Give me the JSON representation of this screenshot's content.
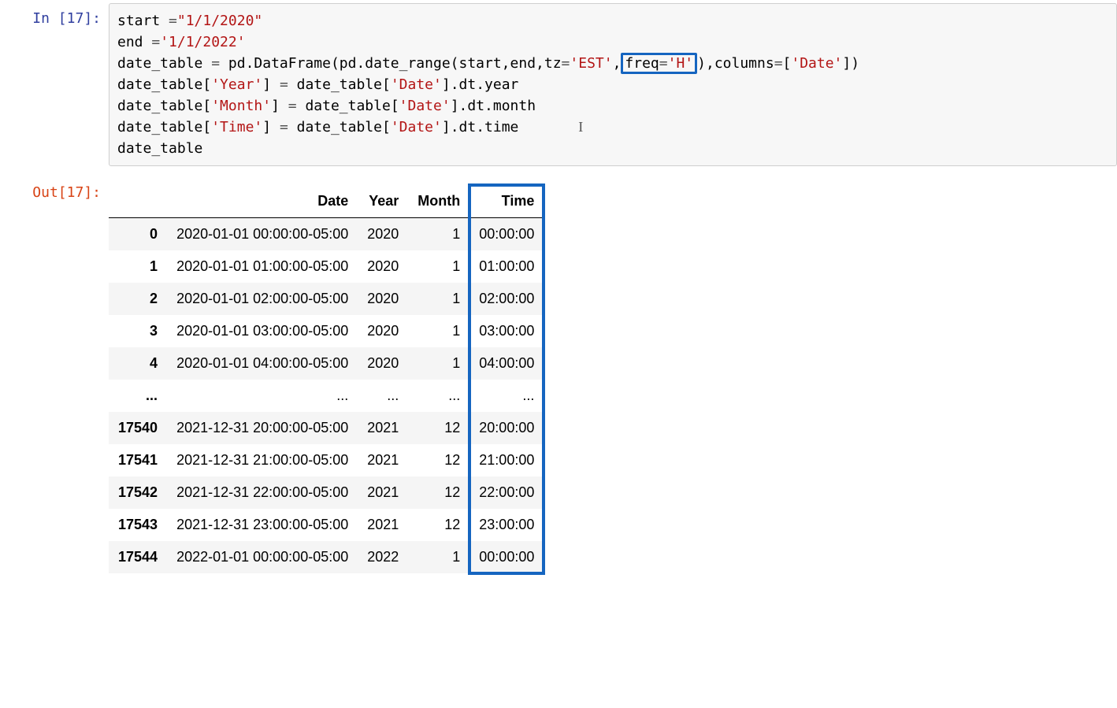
{
  "prompts": {
    "in_label": "In [17]:",
    "out_label": "Out[17]:"
  },
  "code": {
    "line1_a": "start ",
    "line1_eq": "=",
    "line1_str": "\"1/1/2020\"",
    "line2_a": "end ",
    "line2_eq": "=",
    "line2_str": "'1/1/2022'",
    "line3_a": "date_table ",
    "line3_eq": "=",
    "line3_b": " pd.DataFrame(pd.date_range(start,end,tz",
    "line3_eq2": "=",
    "line3_est": "'EST'",
    "line3_comma": ",",
    "line3_hl_a": "freq",
    "line3_hl_eq": "=",
    "line3_hl_str": "'H'",
    "line3_c": "),columns",
    "line3_eq3": "=",
    "line3_c_br": "[",
    "line3_date": "'Date'",
    "line3_c_br2": "])",
    "line4_a": "date_table[",
    "line4_year": "'Year'",
    "line4_b": "] ",
    "line4_eq": "=",
    "line4_c": " date_table[",
    "line4_date": "'Date'",
    "line4_d": "].dt.year",
    "line5_a": "date_table[",
    "line5_month": "'Month'",
    "line5_b": "] ",
    "line5_eq": "=",
    "line5_c": " date_table[",
    "line5_date": "'Date'",
    "line5_d": "].dt.month",
    "line6_a": "date_table[",
    "line6_time": "'Time'",
    "line6_b": "] ",
    "line6_eq": "=",
    "line6_c": " date_table[",
    "line6_date": "'Date'",
    "line6_d": "].dt.time",
    "line7": "date_table",
    "cursor": "I"
  },
  "table": {
    "columns": [
      "Date",
      "Year",
      "Month",
      "Time"
    ],
    "rows": [
      {
        "idx": "0",
        "Date": "2020-01-01 00:00:00-05:00",
        "Year": "2020",
        "Month": "1",
        "Time": "00:00:00"
      },
      {
        "idx": "1",
        "Date": "2020-01-01 01:00:00-05:00",
        "Year": "2020",
        "Month": "1",
        "Time": "01:00:00"
      },
      {
        "idx": "2",
        "Date": "2020-01-01 02:00:00-05:00",
        "Year": "2020",
        "Month": "1",
        "Time": "02:00:00"
      },
      {
        "idx": "3",
        "Date": "2020-01-01 03:00:00-05:00",
        "Year": "2020",
        "Month": "1",
        "Time": "03:00:00"
      },
      {
        "idx": "4",
        "Date": "2020-01-01 04:00:00-05:00",
        "Year": "2020",
        "Month": "1",
        "Time": "04:00:00"
      },
      {
        "idx": "...",
        "Date": "...",
        "Year": "...",
        "Month": "...",
        "Time": "..."
      },
      {
        "idx": "17540",
        "Date": "2021-12-31 20:00:00-05:00",
        "Year": "2021",
        "Month": "12",
        "Time": "20:00:00"
      },
      {
        "idx": "17541",
        "Date": "2021-12-31 21:00:00-05:00",
        "Year": "2021",
        "Month": "12",
        "Time": "21:00:00"
      },
      {
        "idx": "17542",
        "Date": "2021-12-31 22:00:00-05:00",
        "Year": "2021",
        "Month": "12",
        "Time": "22:00:00"
      },
      {
        "idx": "17543",
        "Date": "2021-12-31 23:00:00-05:00",
        "Year": "2021",
        "Month": "12",
        "Time": "23:00:00"
      },
      {
        "idx": "17544",
        "Date": "2022-01-01 00:00:00-05:00",
        "Year": "2022",
        "Month": "1",
        "Time": "00:00:00"
      }
    ]
  }
}
